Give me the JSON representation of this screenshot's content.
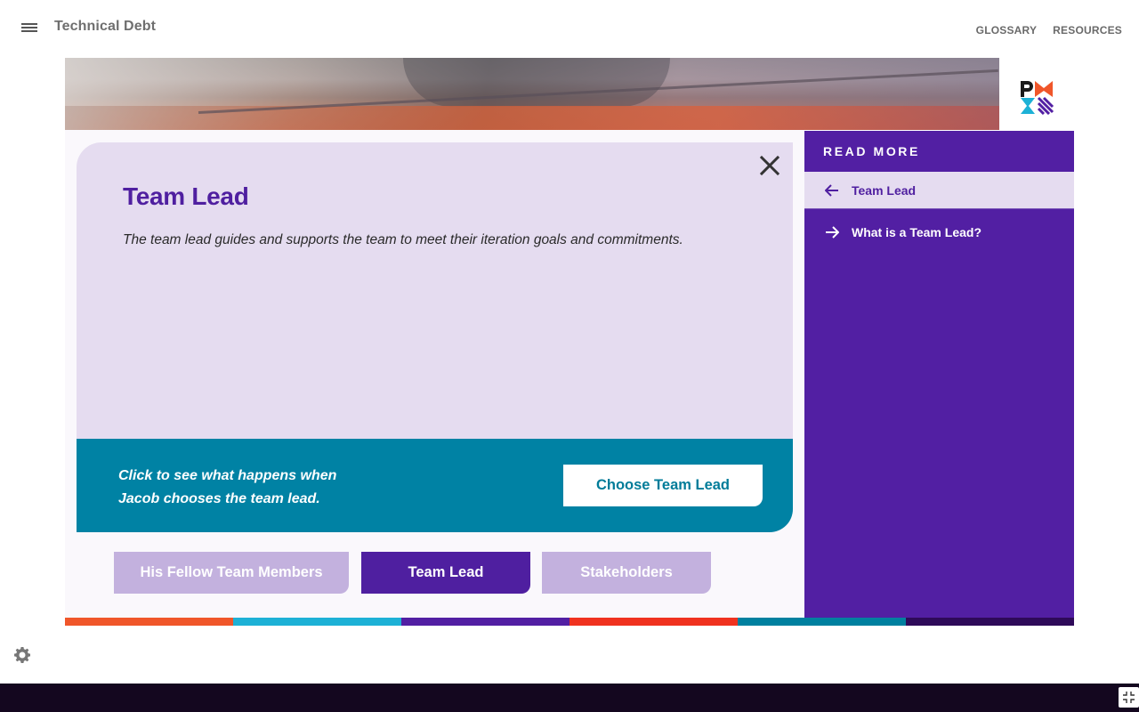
{
  "header": {
    "title": "Technical Debt",
    "nav": [
      "GLOSSARY",
      "RESOURCES"
    ]
  },
  "card": {
    "title": "Team Lead",
    "description": "The team lead guides and supports the team to meet their iteration goals and commitments."
  },
  "cta": {
    "text_line1": "Click to see what happens when",
    "text_line2": "Jacob chooses the team lead.",
    "button_label": "Choose Team Lead"
  },
  "tabs": [
    {
      "label": "His Fellow Team Members",
      "selected": false
    },
    {
      "label": "Team Lead",
      "selected": true
    },
    {
      "label": "Stakeholders",
      "selected": false
    }
  ],
  "sidebar": {
    "heading": "READ MORE",
    "items": [
      {
        "label": "Team Lead",
        "icon": "arrow-left-icon",
        "active": true
      },
      {
        "label": "What is a Team Lead?",
        "icon": "arrow-right-icon",
        "active": false
      }
    ]
  },
  "colors": {
    "purple": "#521fa3",
    "lavender": "#e5dcf0",
    "teal": "#0082a4",
    "tab_inactive": "#c3b1de",
    "stripe": [
      "#f0562a",
      "#1db1d6",
      "#521fa3",
      "#f0321f",
      "#00809f",
      "#2e0a59"
    ]
  }
}
